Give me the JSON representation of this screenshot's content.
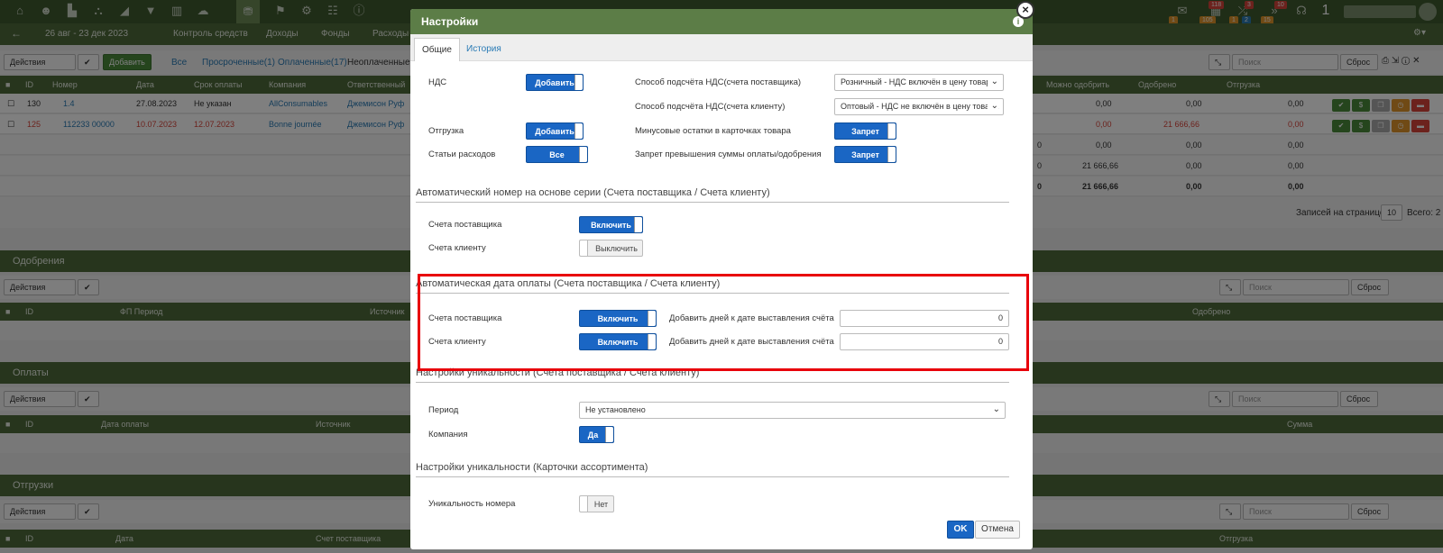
{
  "topbar": {
    "icons": [
      "home-icon",
      "people-icon",
      "factory-icon",
      "hierarchy-icon",
      "chart-icon",
      "filter-icon",
      "bar-chart-icon",
      "cloud-icon",
      "bag-icon",
      "flag-icon",
      "gear-icon",
      "grid-icon",
      "info-icon"
    ],
    "badges": [
      "1",
      "105",
      "118",
      "1",
      "2",
      "3",
      "15",
      "10"
    ],
    "right_number": "1"
  },
  "navbar": {
    "back_arrow": "←",
    "date_range": "26 авг - 23 дек 2023",
    "links": [
      "Контроль средств",
      "Доходы",
      "Фонды",
      "Расходы"
    ]
  },
  "invoices": {
    "toolbar": {
      "actions": "Действия",
      "add": "Добавить",
      "filters": [
        "Все",
        "Просроченные(1)",
        "Оплаченные(17)",
        "Неоплаченные"
      ],
      "search_placeholder": "Поиск",
      "reset": "Сброс"
    },
    "columns": [
      "ID",
      "Номер",
      "Дата",
      "Срок оплаты",
      "Компания",
      "Ответственный",
      "Можно одобрить",
      "Одобрено",
      "Отгрузка"
    ],
    "rows": [
      {
        "id": "130",
        "number": "1.4",
        "date": "27.08.2023",
        "due": "Не указан",
        "company": "AllConsumables",
        "owner": "Джемисон Руф",
        "can_approve": "0,00",
        "approved": "0,00",
        "shipment": "0,00"
      },
      {
        "id": "125",
        "number": "112233 00000",
        "date": "10.07.2023",
        "due": "12.07.2023",
        "company": "Bonne journée",
        "owner": "Джемисон Руф",
        "can_approve": "0,00",
        "approved": "21 666,66",
        "shipment": "0,00"
      }
    ],
    "totals": [
      {
        "a": "0",
        "b": "0,00",
        "c": "0,00",
        "d": "0,00"
      },
      {
        "a": "0",
        "b": "21 666,66",
        "c": "0,00",
        "d": "0,00"
      },
      {
        "a": "0",
        "b": "21 666,66",
        "c": "0,00",
        "d": "0,00"
      }
    ],
    "per_page_label": "Записей на странице",
    "per_page_value": "10",
    "total_label": "Всего: 2"
  },
  "approvals": {
    "title": "Одобрения",
    "actions": "Действия",
    "columns": [
      "ID",
      "ФП Период",
      "Источник",
      "Одобрено"
    ],
    "search_placeholder": "Поиск",
    "reset": "Сброс"
  },
  "payments": {
    "title": "Оплаты",
    "actions": "Действия",
    "columns": [
      "ID",
      "Дата оплаты",
      "Источник",
      "Сумма"
    ],
    "search_placeholder": "Поиск",
    "reset": "Сброс"
  },
  "shipments": {
    "title": "Отгрузки",
    "actions": "Действия",
    "columns": [
      "ID",
      "Дата",
      "Счет поставщика",
      "Отгрузка"
    ],
    "search_placeholder": "Поиск",
    "reset": "Сброс"
  },
  "modal": {
    "title": "Настройки",
    "tabs": [
      "Общие",
      "История"
    ],
    "vat_label": "НДС",
    "vat_toggle": "Добавить",
    "shipment_label": "Отгрузка",
    "shipment_toggle": "Добавить",
    "expense_label": "Статьи расходов",
    "expense_toggle": "Все",
    "vat_supplier_label": "Способ подсчёта НДС(счета поставщика)",
    "vat_supplier_value": "Розничный - НДС включён в цену товара",
    "vat_client_label": "Способ подсчёта НДС(счета клиенту)",
    "vat_client_value": "Оптовый - НДС не включён в цену товара",
    "negative_label": "Минусовые остатки в карточках товара",
    "negative_toggle": "Запрет",
    "exceed_label": "Запрет превышения суммы оплаты/одобрения",
    "exceed_toggle": "Запрет",
    "auto_number": {
      "title": "Автоматический номер на основе серии (Счета поставщика / Счета клиенту)",
      "supplier_label": "Счета поставщика",
      "supplier_toggle": "Включить",
      "client_label": "Счета клиенту",
      "client_toggle": "Выключить"
    },
    "auto_date": {
      "title": "Автоматическая дата оплаты (Счета поставщика / Счета клиенту)",
      "supplier_label": "Счета поставщика",
      "supplier_toggle": "Включить",
      "client_label": "Счета клиенту",
      "client_toggle": "Включить",
      "days_label": "Добавить дней к дате выставления счёта",
      "supplier_days": "0",
      "client_days": "0"
    },
    "uniqueness": {
      "title": "Настройки уникальности (Счета поставщика / Счета клиенту)",
      "period_label": "Период",
      "period_value": "Не установлено",
      "company_label": "Компания",
      "company_toggle": "Да"
    },
    "card_uniqueness": {
      "title": "Настройки уникальности (Карточки ассортимента)",
      "number_label": "Уникальность номера",
      "number_toggle": "Нет"
    },
    "ok": "OK",
    "cancel": "Отмена"
  },
  "colors": {
    "header_green": "#4e6b3b",
    "modal_header": "#5c7d47",
    "toggle_blue": "#1a66c4",
    "highlight_red": "#e8000b"
  }
}
